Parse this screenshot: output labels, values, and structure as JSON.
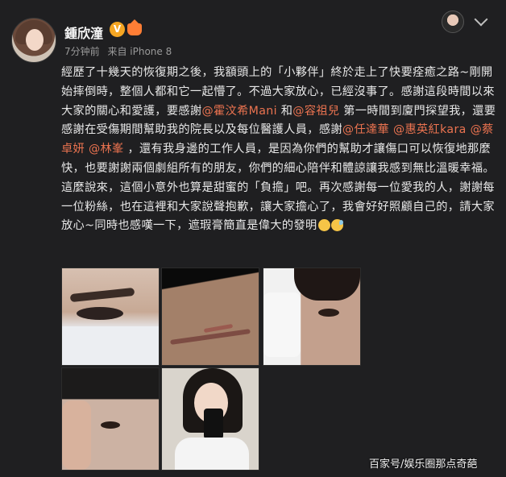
{
  "header": {
    "username": "鍾欣潼",
    "vbadge": "V",
    "meta_time": "7分钟前",
    "meta_source": "来自 iPhone 8"
  },
  "post": {
    "seg1": "經歷了十幾天的恢復期之後，我額頭上的「小夥伴」終於走上了快要痊癒之路~剛開始摔倒時，整個人都和它一起懵了。不過大家放心，已經沒事了。感謝這段時間以來大家的關心和愛護，要感謝",
    "m1": "@霍汶希Mani",
    "seg2": " 和",
    "m2": "@容祖兒",
    "seg3": " 第一時間到廈門探望我，還要感謝在受傷期間幫助我的院長以及每位醫護人員，感謝",
    "m3": "@任達華",
    "seg4": " ",
    "m4": "@惠英紅kara",
    "seg5": " ",
    "m5": "@蔡卓妍",
    "seg6": " ",
    "m6": "@林峯",
    "seg7": " ，還有我身邊的工作人員，是因為你們的幫助才讓傷口可以恢復地那麼快，也要謝謝兩個劇組所有的朋友，你們的細心陪伴和體諒讓我感到無比溫暖幸福。這麼說來，這個小意外也算是甜蜜的「負擔」吧。再次感謝每一位愛我的人，謝謝每一位粉絲，也在這裡和大家說聲抱歉，讓大家擔心了，我會好好照顧自己的，請大家放心~同時也感嘆一下，遮瑕膏簡直是偉大的發明"
  },
  "watermark": "百家号/娱乐圈那点奇葩",
  "colors": {
    "background": "#1f1f21",
    "mention": "#eb7350",
    "text": "#e8e8e8",
    "meta": "#9a9a9a"
  }
}
